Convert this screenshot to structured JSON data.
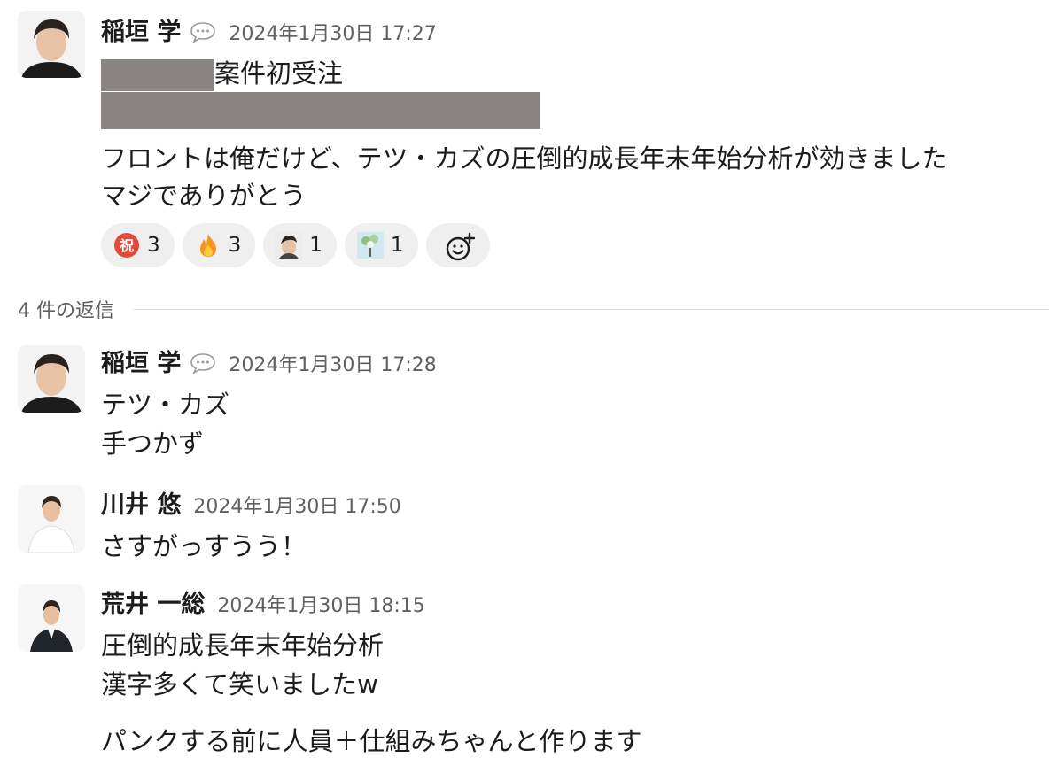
{
  "messages": [
    {
      "author": "稲垣 学",
      "time": "2024年1月30日 17:27",
      "line1_suffix": "案件初受注",
      "line3": "フロントは俺だけど、テツ・カズの圧倒的成長年末年始分析が効きました",
      "line4": "マジでありがとう"
    },
    {
      "author": "稲垣 学",
      "time": "2024年1月30日 17:28",
      "line1": "テツ・カズ",
      "line2": "手つかず"
    },
    {
      "author": "川井 悠",
      "time": "2024年1月30日 17:50",
      "line1": "さすがっすうう！"
    },
    {
      "author": "荒井 一総",
      "time": "2024年1月30日 18:15",
      "line1": "圧倒的成長年末年始分析",
      "line2": "漢字多くて笑いましたw",
      "line3": "パンクする前に人員＋仕組みちゃんと作ります"
    }
  ],
  "reactions": [
    {
      "emoji": "祝",
      "icon": "celebrate-icon",
      "count": "3"
    },
    {
      "emoji": "🔥",
      "icon": "fire-icon",
      "count": "3"
    },
    {
      "emoji": "custom-person",
      "icon": "custom-person-emoji-icon",
      "count": "1"
    },
    {
      "emoji": "custom-tree",
      "icon": "custom-tree-emoji-icon",
      "count": "1"
    }
  ],
  "replies_label": "4 件の返信",
  "colors": {
    "redaction": "#8a8582",
    "reaction_bg": "#efefef",
    "celebrate_red": "#e5493a",
    "fire_orange": "#f7931e"
  }
}
